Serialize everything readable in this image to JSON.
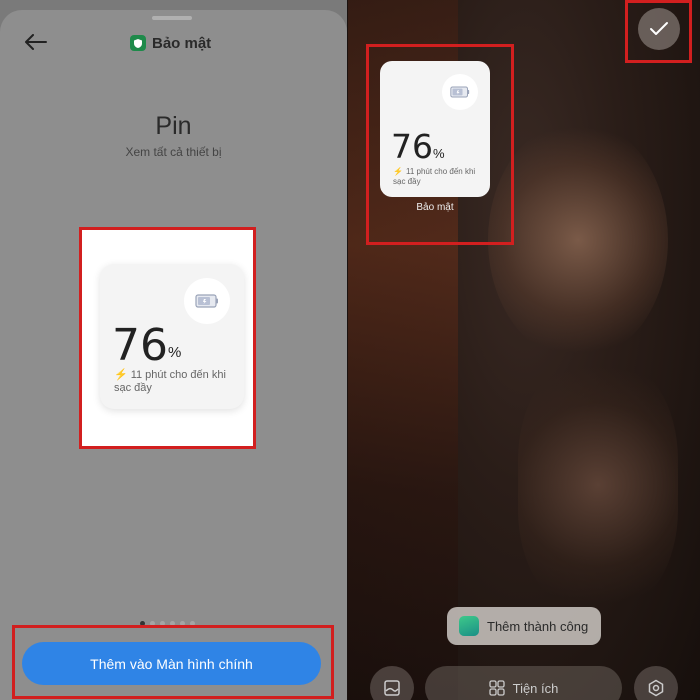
{
  "left": {
    "header": {
      "title": "Bảo mật",
      "icon": "shield-icon"
    },
    "title": "Pin",
    "subtitle": "Xem tất cả thiết bị",
    "widget": {
      "percent": "76",
      "percent_sign": "%",
      "charging_note": "11 phút cho đến khi sạc đầy"
    },
    "pagination": {
      "count": 6,
      "active_index": 0
    },
    "add_button_label": "Thêm vào Màn hình chính"
  },
  "right": {
    "widget": {
      "percent": "76",
      "percent_sign": "%",
      "charging_note": "11 phút cho đến khi sạc đầy",
      "caption": "Bảo mật"
    },
    "toast": "Thêm thành công",
    "bottom_bar": {
      "widgets_label": "Tiện ích"
    }
  },
  "colors": {
    "highlight": "#d21f1f",
    "primary_button": "#2f84e6",
    "charging_bolt": "#2bb54c"
  }
}
